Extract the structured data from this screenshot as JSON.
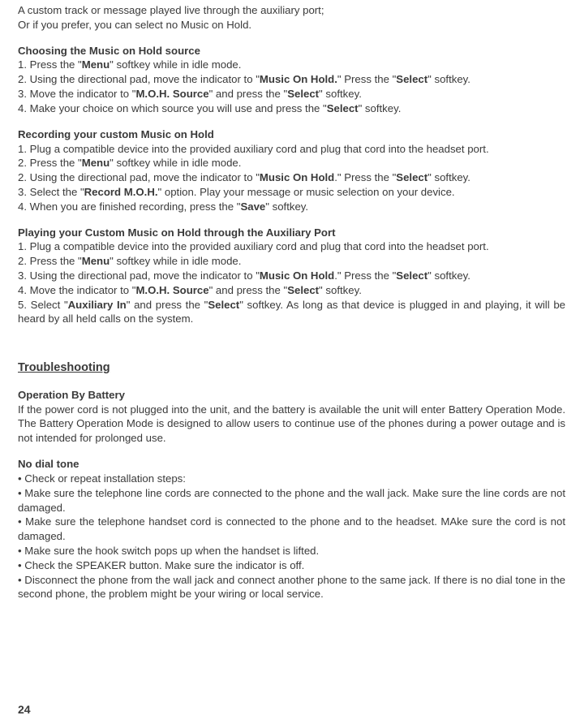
{
  "intro": {
    "line1": "A custom track or message played live through the auxiliary port;",
    "line2": "Or if you prefer, you can select no Music on Hold."
  },
  "choose": {
    "title": "Choosing the Music on Hold source",
    "s1a": "1.  Press the \"",
    "s1b": "Menu",
    "s1c": "\" softkey while in idle mode.",
    "s2a": "2.  Using the directional pad, move the indicator to \"",
    "s2b": "Music On Hold.",
    "s2c": "\"  Press the \"",
    "s2d": "Select",
    "s2e": "\" softkey.",
    "s3a": "3.  Move the indicator to \"",
    "s3b": "M.O.H. Source",
    "s3c": "\" and press the \"",
    "s3d": "Select",
    "s3e": "\" softkey.",
    "s4a": "4.  Make your choice on which source you will use and press the \"",
    "s4b": "Select",
    "s4c": "\" softkey."
  },
  "record": {
    "title": "Recording your custom Music on Hold",
    "s1": "1.  Plug a compatible device into the provided auxiliary cord and plug that cord into the headset port.",
    "s2a": "2.  Press the \"",
    "s2b": "Menu",
    "s2c": "\" softkey while in idle mode.",
    "s3a": "2.  Using the directional pad, move the indicator to \"",
    "s3b": "Music On Hold",
    "s3c": ".\"  Press the \"",
    "s3d": "Select",
    "s3e": "\" softkey.",
    "s4a": "3.  Select the \"",
    "s4b": "Record M.O.H.",
    "s4c": "\" option.  Play your message or music selection on your device.",
    "s5a": "4.  When you are finished recording, press the \"",
    "s5b": "Save",
    "s5c": "\" softkey."
  },
  "play": {
    "title": "Playing your Custom Music on Hold through the Auxiliary Port",
    "s1": "1.  Plug a compatible device into the provided auxiliary cord and plug that cord into the headset port.",
    "s2a": "2.  Press the \"",
    "s2b": "Menu",
    "s2c": "\" softkey while in idle mode.",
    "s3a": "3.  Using the directional pad, move the indicator to \"",
    "s3b": "Music On Hold",
    "s3c": ".\"  Press the \"",
    "s3d": "Select",
    "s3e": "\" softkey.",
    "s4a": "4.  Move the indicator to \"",
    "s4b": "M.O.H. Source",
    "s4c": "\" and press the \"",
    "s4d": "Select",
    "s4e": "\" softkey.",
    "s5a": "5.  Select \"",
    "s5b": "Auxiliary In",
    "s5c": "\" and press the \"",
    "s5d": "Select",
    "s5e": "\" softkey.  As long as that device is plugged in and playing, it will be heard by all held calls on the system."
  },
  "troubleshoot": {
    "heading": "Troubleshooting",
    "battery_title": "Operation By Battery",
    "battery_body": "If the power cord is not plugged into the unit, and the battery is available the unit will enter Battery Operation Mode.  The Battery Operation Mode is designed to allow users to continue use of the phones during a power outage and is not intended for prolonged use.",
    "nodial_title": "No dial tone",
    "b1": "• Check or repeat installation steps:",
    "b2": "• Make sure the telephone line cords are connected to the phone and the wall jack. Make sure the line cords are not damaged.",
    "b3": "• Make sure the telephone handset cord is connected to the phone and to the headset.  MAke sure the cord is not damaged.",
    "b4": "• Make sure the hook switch pops up when the handset is lifted.",
    "b5": "• Check the SPEAKER button. Make sure the indicator is off.",
    "b6": "• Disconnect the phone from the wall jack and connect another phone to the same jack. If there is no dial tone in the second phone, the problem might be your wiring or local service."
  },
  "page_number": "24"
}
